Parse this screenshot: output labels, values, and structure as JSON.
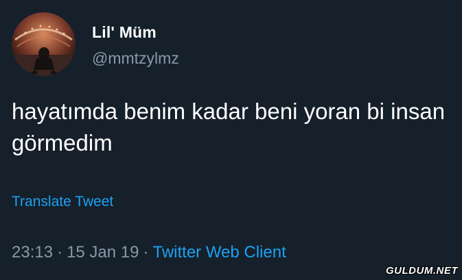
{
  "author": {
    "display_name": "Lil' Müm",
    "handle": "@mmtzylmz",
    "avatar": "profile-photo"
  },
  "tweet": {
    "text": "hayatımda benim kadar beni yoran bi insan görmedim",
    "translate_label": "Translate Tweet",
    "time": "23:13",
    "date": "15 Jan 19",
    "separator": "·",
    "source": "Twitter Web Client"
  },
  "watermark": "GULDUM.NET",
  "colors": {
    "background": "#15202b",
    "text": "#ffffff",
    "secondary": "#8899a6",
    "link": "#1da1f2"
  }
}
